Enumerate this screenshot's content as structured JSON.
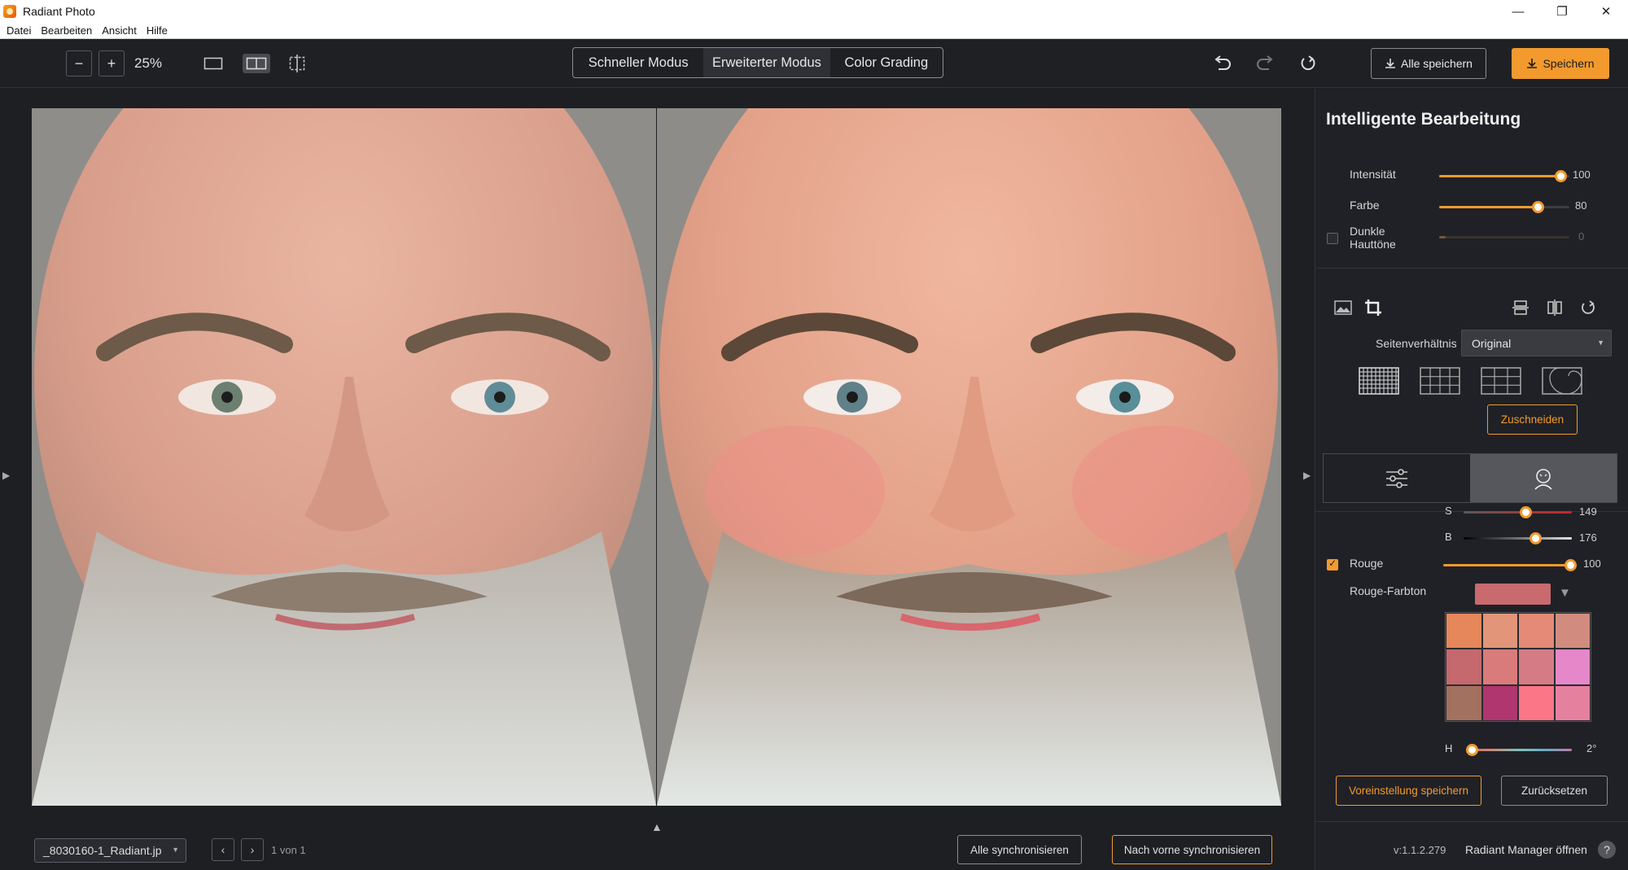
{
  "window": {
    "title": "Radiant Photo",
    "minimize": "—",
    "restore": "❐",
    "close": "✕"
  },
  "menu": {
    "items": [
      "Datei",
      "Bearbeiten",
      "Ansicht",
      "Hilfe"
    ]
  },
  "toolbar": {
    "zoom_out": "−",
    "zoom_in": "+",
    "zoom_level": "25%",
    "modes": [
      "Schneller Modus",
      "Erweiterter Modus",
      "Color Grading"
    ],
    "active_mode": "Erweiterter Modus",
    "save_all_label": "Alle speichern",
    "save_label": "Speichern"
  },
  "panel": {
    "title": "Intelligente Bearbeitung",
    "sliders": [
      {
        "label": "Intensität",
        "value": "100",
        "fraction": 1.0
      },
      {
        "label": "Farbe",
        "value": "80",
        "fraction": 0.8
      },
      {
        "label": "Dunkle Hauttöne",
        "value": "0",
        "fraction": 0.0
      }
    ],
    "aspect_label": "Seitenverhältnis",
    "aspect_value": "Original",
    "crop_label": "Zuschneiden",
    "s_label": "S",
    "s_value": "149",
    "b_label": "B",
    "b_value": "176",
    "rouge_label": "Rouge",
    "rouge_value": "100",
    "rouge_tone_label": "Rouge-Farbton",
    "h_label": "H",
    "h_value": "2°",
    "preset_label": "Voreinstellung speichern",
    "reset_label": "Zurücksetzen",
    "version": "v:1.1.2.279",
    "manager_label": "Radiant Manager öffnen",
    "help": "?"
  },
  "colors": {
    "accent": "#f29a2e",
    "rouge_tone": "#c96a6e",
    "swatches": [
      "#e5865b",
      "#e29579",
      "#e58a76",
      "#d18c7f",
      "#c5696e",
      "#d97b7b",
      "#d57b85",
      "#e687c9",
      "#a3715f",
      "#b0366f",
      "#fb7686",
      "#e5819f"
    ]
  },
  "bottom": {
    "file_name": "_8030160-1_Radiant.jp",
    "prev": "‹",
    "next": "›",
    "counter": "1 von 1",
    "sync_all_label": "Alle synchronisieren",
    "sync_front_label": "Nach vorne synchronisieren"
  }
}
